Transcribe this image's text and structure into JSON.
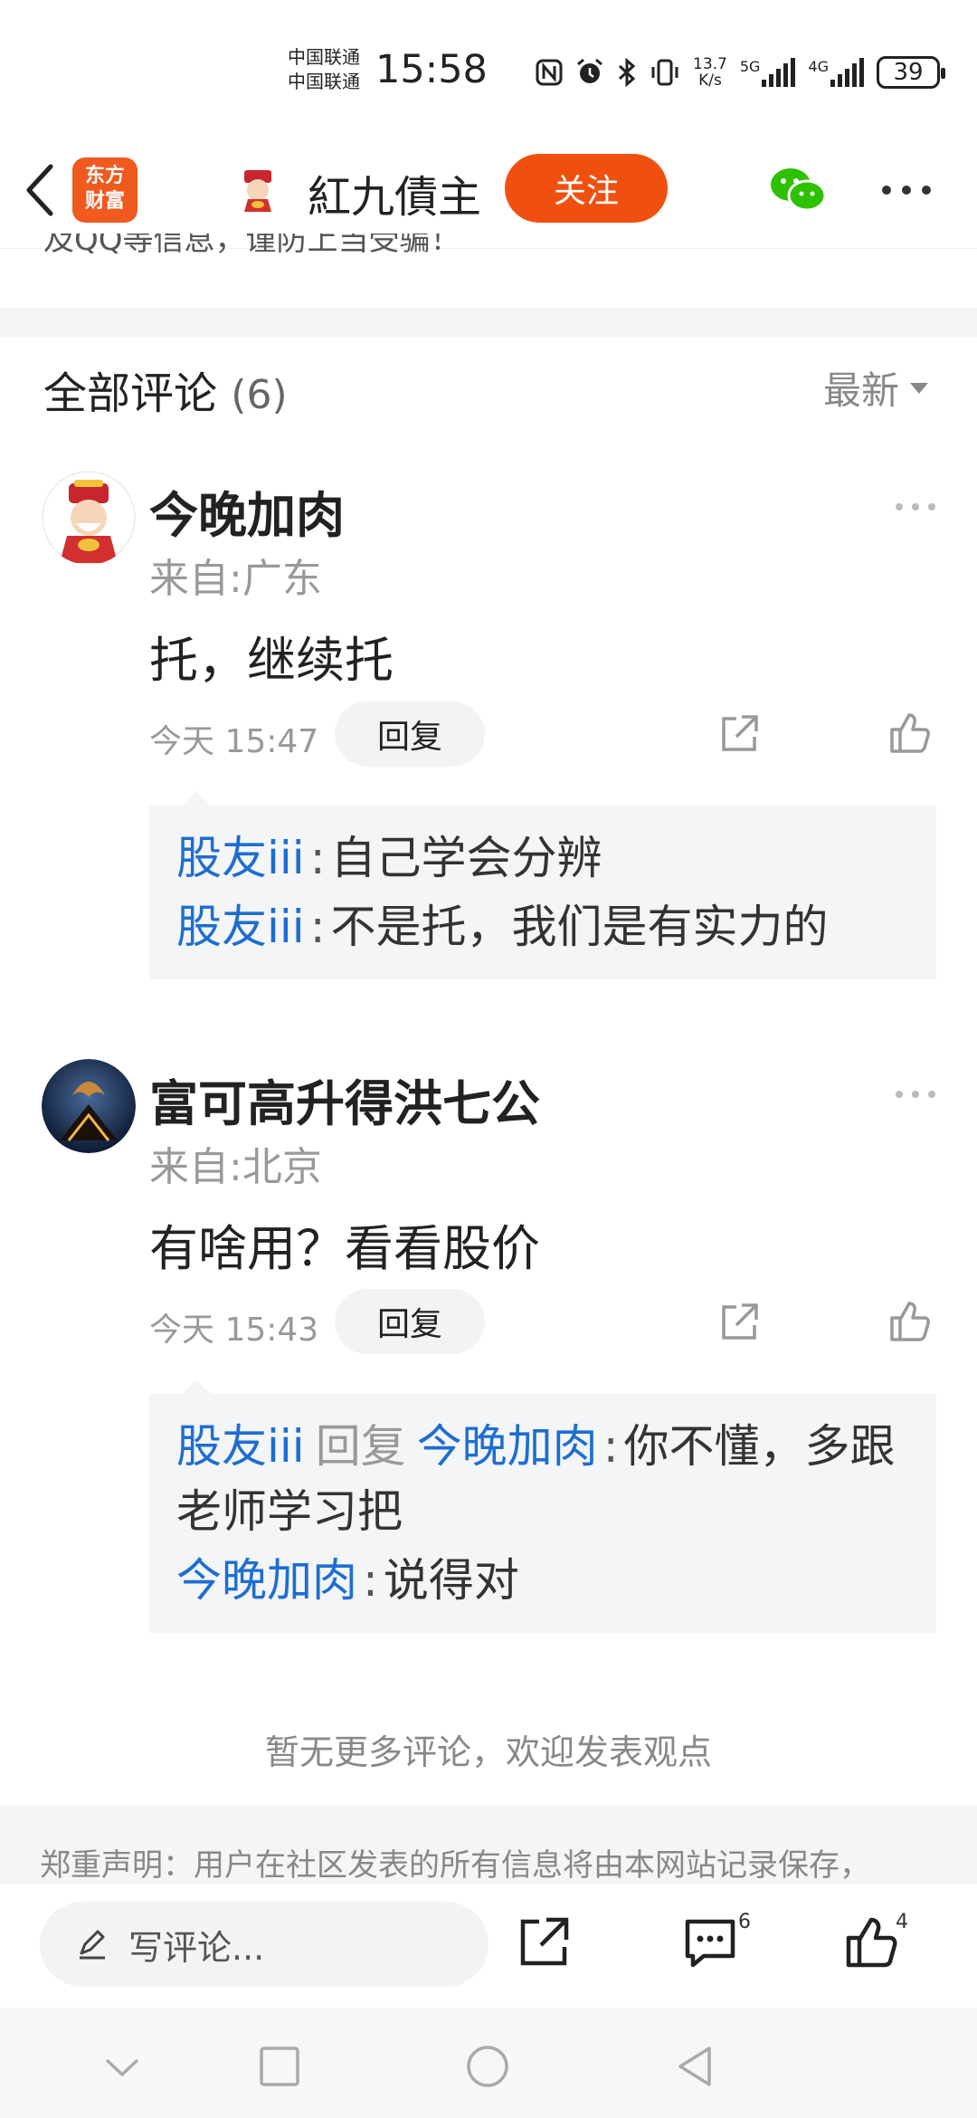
{
  "status_bar": {
    "carrier_1": "中国联通",
    "carrier_2": "中国联通",
    "time": "15:58",
    "net_speed_value": "13.7",
    "net_speed_unit": "K/s",
    "sim1_type": "5G",
    "sim2_type": "4G",
    "battery": "39"
  },
  "topnav": {
    "app_logo_line1": "东方",
    "app_logo_line2": "财富",
    "author_name": "紅九債主",
    "follow_label": "关注"
  },
  "clipped_notice": "及QQ等信息，谨防上当受骗！",
  "comments": {
    "title": "全部评论",
    "count": "(6)",
    "sort_label": "最新",
    "items": [
      {
        "name": "今晚加肉",
        "location": "来自:广东",
        "text": "托，继续托",
        "time": "今天 15:47",
        "reply_label": "回复",
        "replies": [
          {
            "user": "股友iii",
            "sep": ":",
            "text": "自己学会分辨"
          },
          {
            "user": "股友iii",
            "sep": ":",
            "text": "不是托，我们是有实力的"
          }
        ]
      },
      {
        "name": "富可高升得洪七公",
        "location": "来自:北京",
        "text": "有啥用？看看股价",
        "time": "今天 15:43",
        "reply_label": "回复",
        "replies": [
          {
            "user": "股友iii",
            "reply_word": "回复",
            "target": "今晚加肉",
            "sep": ":",
            "text": "你不懂，多跟老师学习把"
          },
          {
            "user": "今晚加肉",
            "sep": ":",
            "text": "说得对"
          }
        ]
      }
    ],
    "no_more": "暂无更多评论，欢迎发表观点"
  },
  "disclaimer": "郑重声明：用户在社区发表的所有信息将由本网站记录保存，",
  "bottom_bar": {
    "write_placeholder": "写评论...",
    "comment_count": "6",
    "like_count": "4"
  },
  "colors": {
    "accent_orange": "#f0500f",
    "link_blue": "#1e6ed0",
    "wechat_green": "#2dc100",
    "band_gray": "#f4f5f7"
  },
  "icons": [
    "back-icon",
    "wechat-icon",
    "more-icon",
    "share-icon",
    "like-icon",
    "pencil-icon",
    "comment-icon",
    "nav-down-icon",
    "nav-square-icon",
    "nav-circle-icon",
    "nav-back-triangle-icon"
  ]
}
